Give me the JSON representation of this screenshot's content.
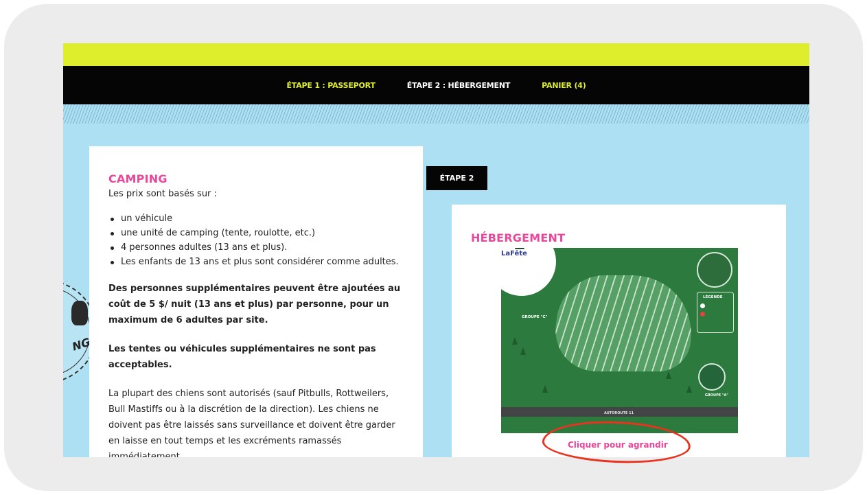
{
  "nav": {
    "step1": "ÉTAPE 1 : PASSEPORT",
    "step2": "ÉTAPE 2 : HÉBERGEMENT",
    "cart": "PANIER (4)"
  },
  "stamp": {
    "text": "NG"
  },
  "camping": {
    "title": "CAMPING",
    "intro": "Les prix sont basés sur :",
    "bullets": [
      "un véhicule",
      "une unité de camping (tente, roulotte, etc.)",
      "4 personnes adultes (13 ans et plus).",
      "Les enfants de 13 ans et plus sont considérer comme adultes."
    ],
    "extra_people": "Des personnes supplémentaires peuvent être ajoutées au coût de 5 $/ nuit (13 ans et plus) par personne, pour un maximum de 6 adultes par site.",
    "tents": "Les tentes ou véhicules supplémentaires ne sont pas acceptables.",
    "dogs": "La plupart des chiens sont autorisés (sauf Pitbulls, Rottweilers, Bull Mastiffs ou à la discrétion de la direction). Les chiens ne doivent pas être laissés sans surveillance et doivent être garder en laisse en tout temps et les excréments ramassés immédiatement."
  },
  "step_badge": "ÉTAPE 2",
  "hebergement": {
    "title": "HÉBERGEMENT",
    "map": {
      "logo": "LaFête",
      "legend": "LÉGENDE",
      "group_c": "GROUPE \"C\"",
      "group_a": "GROUPE \"A\"",
      "road": "AUTOROUTE 11"
    },
    "enlarge": "Cliquer pour agrandir"
  },
  "colors": {
    "accent_pink": "#e8479a",
    "yellow": "#dfee2c",
    "nav_black": "#050505",
    "sky": "#aee0f3",
    "annotation_red": "#e8331f"
  }
}
